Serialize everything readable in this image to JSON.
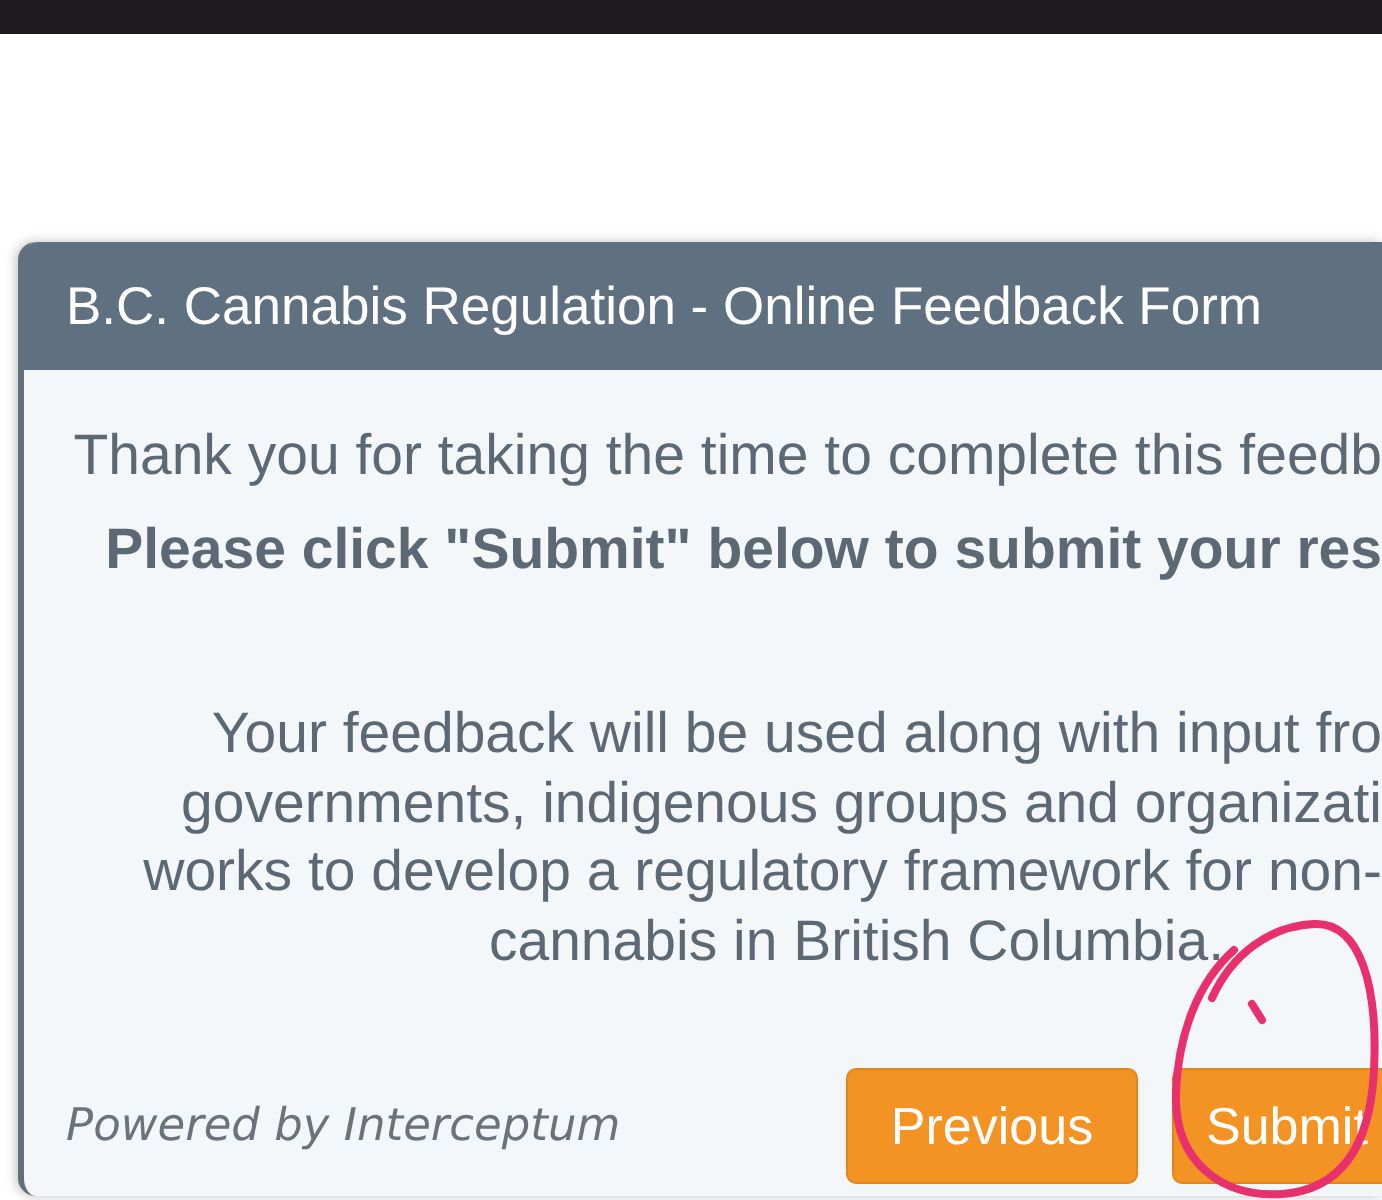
{
  "dialog": {
    "title": "B.C. Cannabis Regulation - Online Feedback Form",
    "intro": "Thank you for taking the time to complete this feedb",
    "instruction": "Please click \"Submit\" below to submit your res",
    "message_lines": [
      "Your feedback will be used along with input fro",
      "governments, indigenous groups and organizati",
      "works to develop a regulatory framework for non-",
      "cannabis in British Columbia."
    ],
    "footer": {
      "powered_by": "Powered by Interceptum",
      "buttons": [
        "Previous",
        "Submit"
      ]
    }
  }
}
